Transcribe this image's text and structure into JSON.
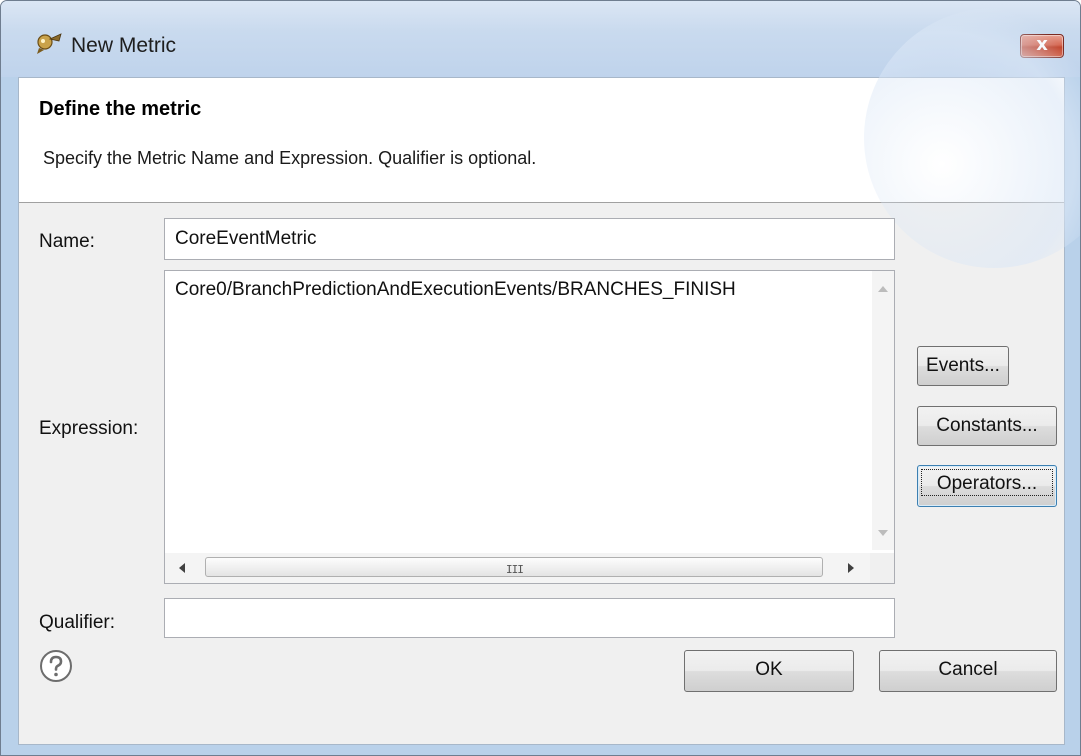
{
  "window": {
    "title": "New Metric",
    "close_symbol": "x"
  },
  "header": {
    "title": "Define the metric",
    "description": "Specify the Metric Name and Expression. Qualifier is optional."
  },
  "form": {
    "name_label": "Name:",
    "name_value": "CoreEventMetric",
    "expression_label": "Expression:",
    "expression_value": "Core0/BranchPredictionAndExecutionEvents/BRANCHES_FINISH",
    "qualifier_label": "Qualifier:",
    "qualifier_value": ""
  },
  "side_buttons": {
    "events": "Events...",
    "constants": "Constants...",
    "operators": "Operators..."
  },
  "footer": {
    "ok": "OK",
    "cancel": "Cancel",
    "help_icon": "question-circle-icon"
  },
  "colors": {
    "titlebar": "#c9daee",
    "close": "#c94f37",
    "focus": "#3c7fb1"
  },
  "scrollbar": {
    "grip": "III"
  }
}
